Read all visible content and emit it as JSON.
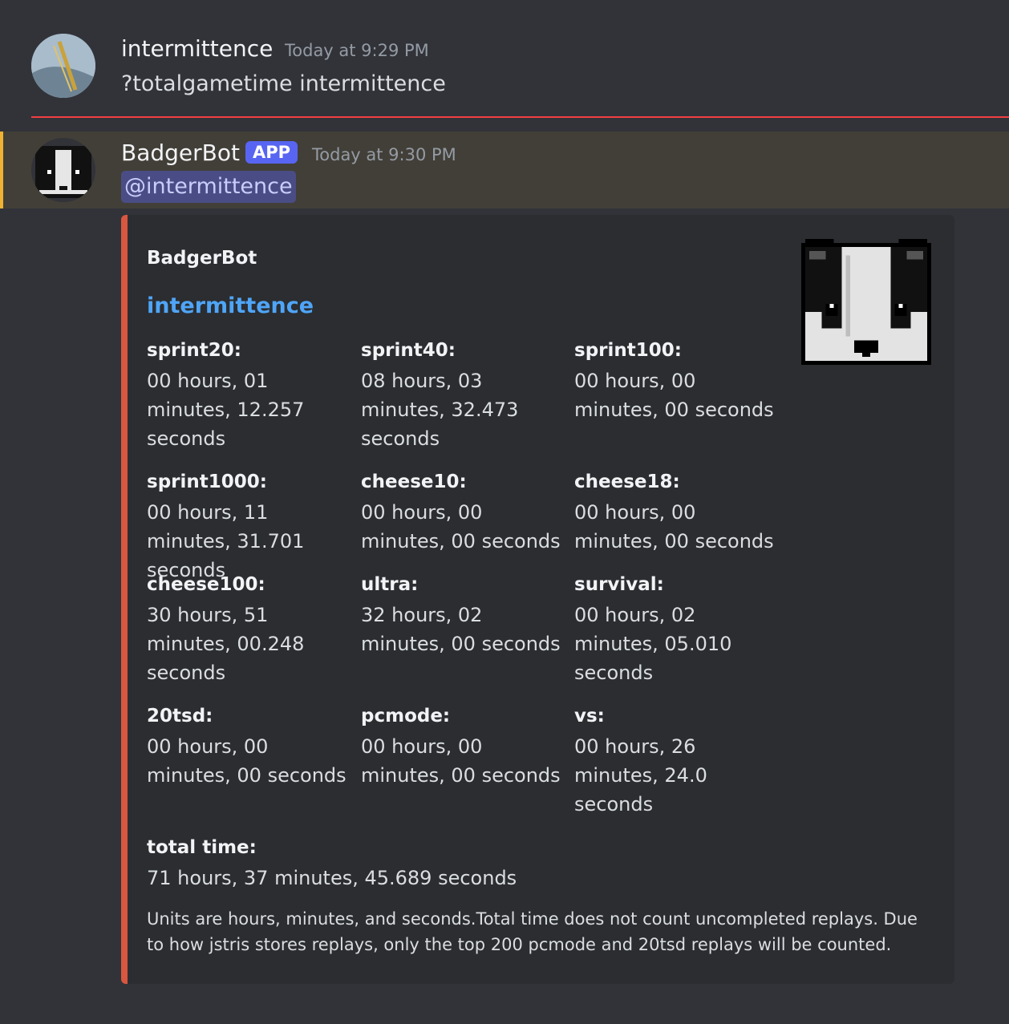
{
  "message1": {
    "username": "intermittence",
    "timestamp": "Today at 9:29 PM",
    "content": "?totalgametime intermittence"
  },
  "message2": {
    "username": "BadgerBot",
    "badge": "APP",
    "timestamp": "Today at 9:30 PM",
    "mention": "@intermittence"
  },
  "embed": {
    "author": "BadgerBot",
    "title": "intermittence",
    "fields": [
      {
        "name": "sprint20:",
        "value": "00 hours, 01 minutes, 12.257 seconds"
      },
      {
        "name": "sprint40:",
        "value": "08 hours, 03 minutes, 32.473 seconds"
      },
      {
        "name": "sprint100:",
        "value": "00 hours, 00 minutes, 00 seconds"
      },
      {
        "name": "sprint1000:",
        "value": "00 hours, 11 minutes, 31.701 seconds"
      },
      {
        "name": "cheese10:",
        "value": "00 hours, 00 minutes, 00 seconds"
      },
      {
        "name": "cheese18:",
        "value": "00 hours, 00 minutes, 00 seconds"
      },
      {
        "name": "cheese100:",
        "value": "30 hours, 51 minutes, 00.248 seconds"
      },
      {
        "name": "ultra:",
        "value": "32 hours, 02 minutes, 00 seconds"
      },
      {
        "name": "survival:",
        "value": "00 hours, 02 minutes, 05.010 seconds"
      },
      {
        "name": "20tsd:",
        "value": "00 hours, 00 minutes, 00 seconds"
      },
      {
        "name": "pcmode:",
        "value": "00 hours, 00 minutes, 00 seconds"
      },
      {
        "name": "vs:",
        "value": "00 hours, 26 minutes, 24.0 seconds"
      },
      {
        "name": "total time:",
        "value": "71 hours, 37 minutes, 45.689 seconds"
      }
    ],
    "footer": "Units are hours, minutes, and seconds.Total time does not count uncompleted replays. Due to how jstris stores replays, only the top 200 pcmode and 20tsd replays will be counted.",
    "accent_color": "#d8573f"
  },
  "colors": {
    "background": "#323339",
    "embed_background": "#2b2d31",
    "link": "#4fa5f7",
    "app_badge": "#5865f2",
    "highlight_bar": "#f0b232",
    "new_divider": "#f23f43"
  }
}
